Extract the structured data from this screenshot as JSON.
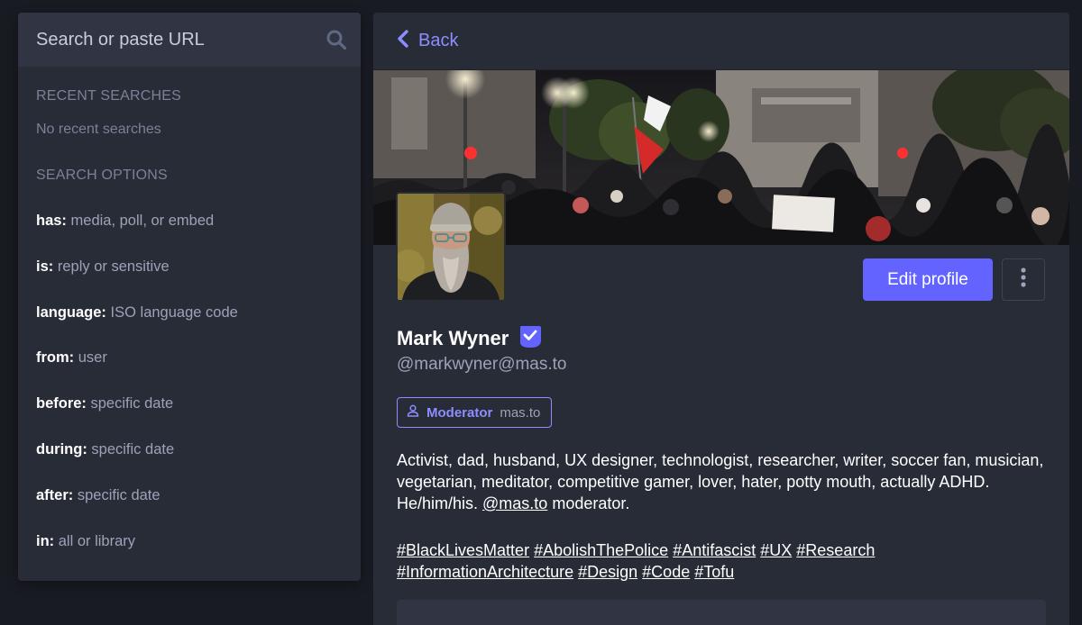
{
  "search": {
    "placeholder": "Search or paste URL",
    "recent_heading": "Recent searches",
    "recent_empty": "No recent searches",
    "options_heading": "Search options",
    "options": [
      {
        "key": "has:",
        "desc": " media, poll, or embed"
      },
      {
        "key": "is:",
        "desc": " reply or sensitive"
      },
      {
        "key": "language:",
        "desc": " ISO language code"
      },
      {
        "key": "from:",
        "desc": " user"
      },
      {
        "key": "before:",
        "desc": " specific date"
      },
      {
        "key": "during:",
        "desc": " specific date"
      },
      {
        "key": "after:",
        "desc": " specific date"
      },
      {
        "key": "in:",
        "desc": " all or library"
      }
    ]
  },
  "profile": {
    "back_label": "Back",
    "edit_label": "Edit profile",
    "display_name": "Mark Wyner",
    "handle": "@markwyner@mas.to",
    "role": {
      "name": "Moderator",
      "domain": "mas.to"
    },
    "bio": {
      "part1": "Activist, dad, husband, UX designer, technologist, researcher, writer, soccer fan, musician, vegetarian, meditator, competitive gamer, lover, hater, potty mouth, actually ADHD. He/him/his. ",
      "mention": "@mas.to",
      "part2": " moderator."
    },
    "hashtags": [
      "#BlackLivesMatter",
      "#AbolishThePolice",
      "#Antifascist",
      "#UX",
      "#Research",
      "#InformationArchitecture",
      "#Design",
      "#Code",
      "#Tofu"
    ]
  },
  "colors": {
    "accent": "#6364ff",
    "link": "#8c8dff",
    "panel": "#282c37",
    "background": "#191b22"
  },
  "icons": {
    "search": "search-icon",
    "back": "chevron-left-icon",
    "more": "ellipsis-vertical-icon",
    "verified": "verified-check-icon",
    "role": "user-icon"
  }
}
